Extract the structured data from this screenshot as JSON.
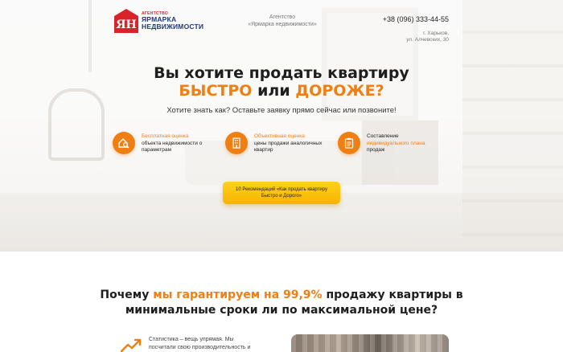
{
  "header": {
    "logo_small": "АГЕНТСТВО",
    "logo_line1": "ЯРМАРКА",
    "logo_line2": "НЕДВИЖИМОСТИ",
    "logo_badge": "ЯН",
    "agency_line1": "Агентство",
    "agency_line2": "«Ярмарка недвижимости»",
    "phone": "+38 (096) 333-44-55",
    "city": "г. Харьков,",
    "street": "ул. Алчевских, 30"
  },
  "hero": {
    "headline_line1": "Вы хотите продать квартиру",
    "headline_fast": "БЫСТРО",
    "headline_or": " или ",
    "headline_expensive": "ДОРОЖЕ?",
    "subheadline": "Хотите знать как? Оставьте заявку прямо сейчас или позвоните!",
    "features": [
      {
        "title": "Бесплатная оценка",
        "text": "объекта недвижимости о параметрам",
        "icon": "house-magnifier-icon"
      },
      {
        "title": "Объективная оценка",
        "text": "цены продажи аналогичных квартир",
        "icon": "building-icon"
      },
      {
        "title": "",
        "text_before": "Составление",
        "title_inline": "индивидуального плана",
        "text": "продаж",
        "icon": "clipboard-icon"
      }
    ],
    "cta_label": "10 Рекомендаций «Как продать квартиру Быстро и Дорого»"
  },
  "why": {
    "part1": "Почему ",
    "accent": "мы гарантируем на 99,9%",
    "part2": " продажу квартиры в",
    "line2": "минимальные сроки ли по максимальной цене?"
  },
  "stats": {
    "line1": "Статистика – вещь упрямая. Мы",
    "line2": "посчитали свою производительность и"
  },
  "colors": {
    "accent": "#f07f13",
    "cta": "#ffc60a",
    "logo_red": "#d8232a",
    "logo_blue": "#1d3a7a"
  }
}
